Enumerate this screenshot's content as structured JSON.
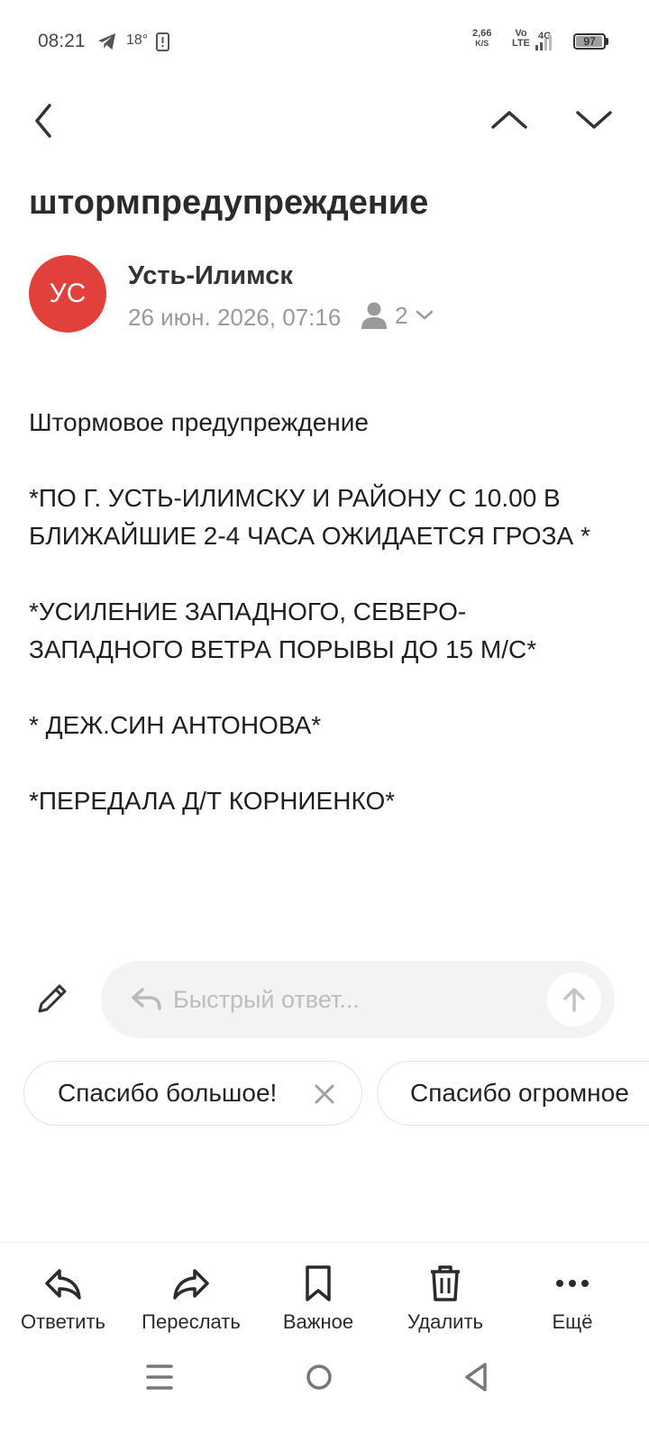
{
  "status_bar": {
    "time": "08:21",
    "temperature": "18°",
    "speed_value": "2,66",
    "speed_unit": "K/S",
    "volte_top": "Vo",
    "volte_bottom": "LTE",
    "network": "4G",
    "battery": "97"
  },
  "header": {
    "back_icon": "chevron-left-icon",
    "prev_icon": "chevron-up-icon",
    "next_icon": "chevron-down-icon"
  },
  "message": {
    "subject": "штормпредупреждение",
    "avatar_initials": "УС",
    "avatar_color": "#e2403a",
    "sender": "Усть-Илимск",
    "date": "26 июн. 2026, 07:16",
    "recipients_count": "2",
    "body": [
      "Штормовое предупреждение",
      "*ПО Г. УСТЬ-ИЛИМСКУ И РАЙОНУ С 10.00 В БЛИЖАЙШИЕ 2-4 ЧАСА ОЖИДАЕТСЯ ГРОЗА *",
      "*УСИЛЕНИЕ ЗАПАДНОГО, СЕВЕРО-ЗАПАДНОГО ВЕТРА ПОРЫВЫ ДО 15 М/С*",
      "* ДЕЖ.СИН АНТОНОВА*",
      "*ПЕРЕДАЛА Д/Т КОРНИЕНКО*"
    ]
  },
  "quick_reply": {
    "placeholder": "Быстрый ответ...",
    "suggestions": [
      "Спасибо большое!",
      "Спасибо огромное"
    ]
  },
  "toolbar": {
    "reply": "Ответить",
    "forward": "Переслать",
    "important": "Важное",
    "delete": "Удалить",
    "more": "Ещё"
  }
}
